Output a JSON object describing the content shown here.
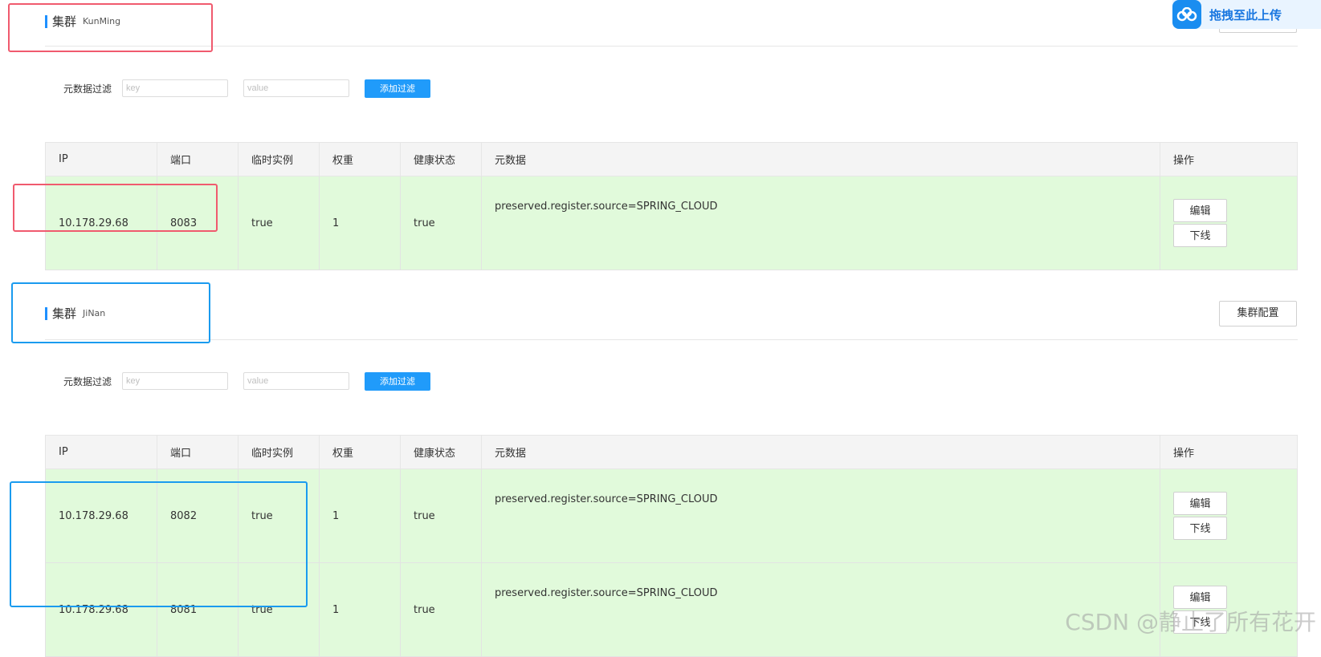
{
  "clusters": [
    {
      "label": "集群",
      "name": "KunMing",
      "filter": {
        "label": "元数据过滤",
        "key_placeholder": "key",
        "value_placeholder": "value",
        "add_button": "添加过滤"
      },
      "rows": [
        {
          "ip": "10.178.29.68",
          "port": "8083",
          "ephemeral": "true",
          "weight": "1",
          "healthy": "true",
          "metadata": "preserved.register.source=SPRING_CLOUD",
          "edit": "编辑",
          "offline": "下线"
        }
      ]
    },
    {
      "label": "集群",
      "name": "JiNan",
      "config_button": "集群配置",
      "filter": {
        "label": "元数据过滤",
        "key_placeholder": "key",
        "value_placeholder": "value",
        "add_button": "添加过滤"
      },
      "rows": [
        {
          "ip": "10.178.29.68",
          "port": "8082",
          "ephemeral": "true",
          "weight": "1",
          "healthy": "true",
          "metadata": "preserved.register.source=SPRING_CLOUD",
          "edit": "编辑",
          "offline": "下线"
        },
        {
          "ip": "10.178.29.68",
          "port": "8081",
          "ephemeral": "true",
          "weight": "1",
          "healthy": "true",
          "metadata": "preserved.register.source=SPRING_CLOUD",
          "edit": "编辑",
          "offline": "下线"
        }
      ]
    }
  ],
  "table_headers": {
    "ip": "IP",
    "port": "端口",
    "ephemeral": "临时实例",
    "weight": "权重",
    "healthy": "健康状态",
    "metadata": "元数据",
    "ops": "操作"
  },
  "upload_widget": {
    "label": "拖拽至此上传",
    "icon": "cloud-icon"
  },
  "watermark": "CSDN @静止了所有花开",
  "colors": {
    "accent": "#209bfa",
    "row_bg": "#e1fadb",
    "annotation_red": "#f05a6e",
    "annotation_blue": "#1a9bef"
  }
}
